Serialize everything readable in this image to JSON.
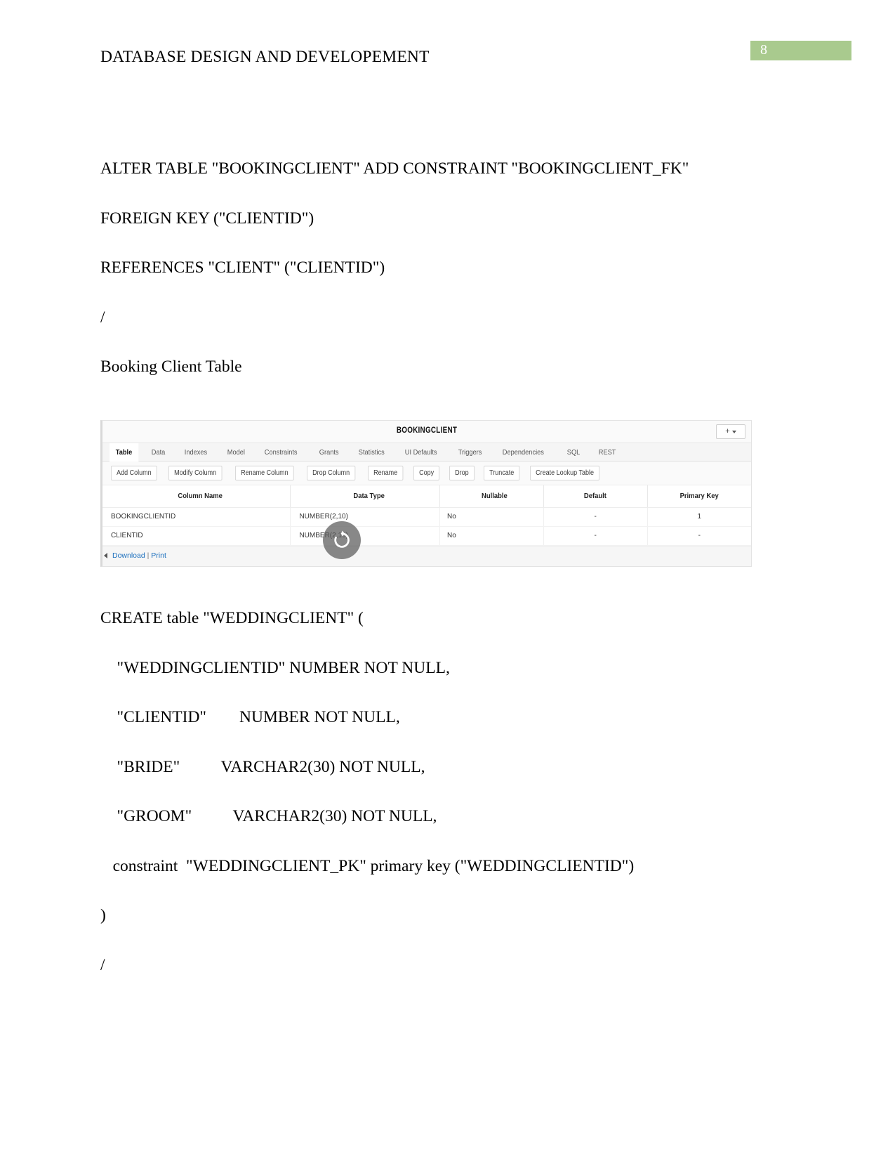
{
  "header": {
    "doc_title": "DATABASE DESIGN AND DEVELOPEMENT",
    "page_number": "8",
    "badge_color": "#a9ca8e"
  },
  "body": {
    "lines_top": [
      "ALTER TABLE \"BOOKINGCLIENT\" ADD CONSTRAINT \"BOOKINGCLIENT_FK\"",
      "FOREIGN KEY (\"CLIENTID\")",
      "REFERENCES \"CLIENT\" (\"CLIENTID\")",
      "/",
      "Booking Client Table"
    ],
    "lines_bottom": [
      "CREATE table \"WEDDINGCLIENT\" (",
      "    \"WEDDINGCLIENTID\" NUMBER NOT NULL,",
      "    \"CLIENTID\"        NUMBER NOT NULL,",
      "    \"BRIDE\"          VARCHAR2(30) NOT NULL,",
      "    \"GROOM\"          VARCHAR2(30) NOT NULL,",
      "   constraint  \"WEDDINGCLIENT_PK\" primary key (\"WEDDINGCLIENTID\")",
      ")",
      "/"
    ]
  },
  "apex": {
    "title": "BOOKINGCLIENT",
    "add_button_label": "+",
    "tabs": [
      {
        "label": "Table",
        "active": true
      },
      {
        "label": "Data",
        "active": false
      },
      {
        "label": "Indexes",
        "active": false
      },
      {
        "label": "Model",
        "active": false
      },
      {
        "label": "Constraints",
        "active": false
      },
      {
        "label": "Grants",
        "active": false
      },
      {
        "label": "Statistics",
        "active": false
      },
      {
        "label": "UI Defaults",
        "active": false
      },
      {
        "label": "Triggers",
        "active": false
      },
      {
        "label": "Dependencies",
        "active": false
      },
      {
        "label": "SQL",
        "active": false
      },
      {
        "label": "REST",
        "active": false
      }
    ],
    "toolbar_buttons": [
      "Add Column",
      "Modify Column",
      "Rename Column",
      "Drop Column",
      "Rename",
      "Copy",
      "Drop",
      "Truncate",
      "Create Lookup Table"
    ],
    "grid": {
      "headers": [
        "Column Name",
        "Data Type",
        "Nullable",
        "Default",
        "Primary Key"
      ],
      "rows": [
        {
          "column_name": "BOOKINGCLIENTID",
          "data_type": "NUMBER(2,10)",
          "nullable": "No",
          "default": "-",
          "primary_key": "1"
        },
        {
          "column_name": "CLIENTID",
          "data_type": "NUMBER(2,10)",
          "nullable": "No",
          "default": "-",
          "primary_key": "-"
        }
      ]
    },
    "footer": {
      "download_label": "Download",
      "separator": "|",
      "print_label": "Print",
      "link_color": "#1a6ebd"
    },
    "spinner": "refresh-spinner"
  }
}
